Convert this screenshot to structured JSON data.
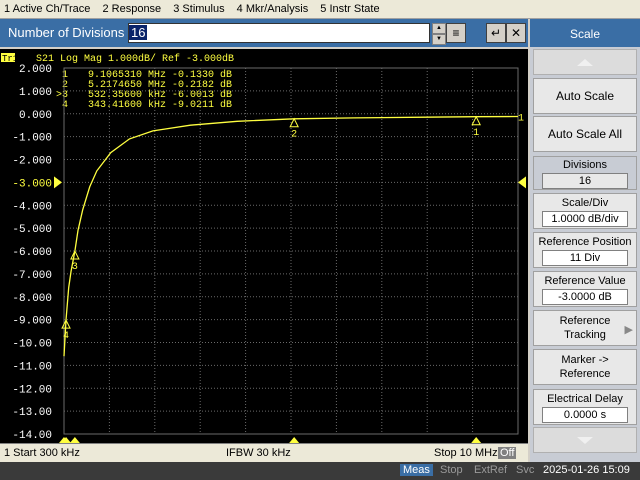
{
  "menu": [
    "1 Active Ch/Trace",
    "2 Response",
    "3 Stimulus",
    "4 Mkr/Analysis",
    "5 Instr State"
  ],
  "entry": {
    "label": "Number of Divisions",
    "value": "16"
  },
  "trace_header": {
    "badge": "Tr1",
    "text": "S21 Log Mag 1.000dB/ Ref -3.000dB"
  },
  "markers_table": [
    {
      "id": "1",
      "freq": "9.1065310 MHz",
      "val": "-0.1330 dB"
    },
    {
      "id": "2",
      "freq": "5.2174650 MHz",
      "val": "-0.2182 dB"
    },
    {
      "id": ">3",
      "freq": "532.35600 kHz",
      "val": "-6.0013 dB"
    },
    {
      "id": "4",
      "freq": "343.41600 kHz",
      "val": "-9.0211 dB"
    }
  ],
  "chart_data": {
    "type": "line",
    "ylim": [
      -14,
      2
    ],
    "xlim_hz": [
      300000,
      10000000
    ],
    "y_ticks": [
      "2.000",
      "1.000",
      "0.000",
      "-1.000",
      "-2.000",
      "-3.000",
      "-4.000",
      "-5.000",
      "-6.000",
      "-7.000",
      "-8.000",
      "-9.000",
      "-10.00",
      "-11.00",
      "-12.00",
      "-13.00",
      "-14.00"
    ],
    "reference_level": -3.0,
    "x_hz": [
      300000,
      343416,
      400000,
      450000,
      532356,
      600000,
      700000,
      850000,
      1000000,
      1300000,
      1700000,
      2200000,
      3000000,
      4000000,
      5217465,
      6500000,
      8000000,
      9106531,
      10000000
    ],
    "y_db": [
      -10.6,
      -9.02,
      -7.6,
      -6.9,
      -6.0,
      -5.1,
      -4.2,
      -3.2,
      -2.5,
      -1.7,
      -1.1,
      -0.75,
      -0.5,
      -0.33,
      -0.22,
      -0.18,
      -0.15,
      -0.13,
      -0.12
    ],
    "markers": [
      {
        "label": "1",
        "x_hz": 9106531,
        "y_db": -0.133
      },
      {
        "label": "2",
        "x_hz": 5217465,
        "y_db": -0.2182
      },
      {
        "label": "3",
        "x_hz": 532356,
        "y_db": -6.0013
      },
      {
        "label": "4",
        "x_hz": 343416,
        "y_db": -9.0211
      }
    ]
  },
  "status": {
    "start": "1  Start 300 kHz",
    "ifbw": "IFBW 30 kHz",
    "stop": "Stop 10 MHz",
    "off": "Off"
  },
  "bottom": {
    "meas": "Meas",
    "stop": "Stop",
    "extref": "ExtRef",
    "svc": "Svc",
    "datetime": "2025-01-26 15:09"
  },
  "softkeys": {
    "title": "Scale",
    "auto_scale": "Auto Scale",
    "auto_scale_all": "Auto Scale All",
    "divisions": {
      "label": "Divisions",
      "value": "16"
    },
    "scale_div": {
      "label": "Scale/Div",
      "value": "1.0000 dB/div"
    },
    "ref_pos": {
      "label": "Reference Position",
      "value": "11 Div"
    },
    "ref_val": {
      "label": "Reference Value",
      "value": "-3.0000 dB"
    },
    "ref_track": "Reference Tracking",
    "marker_ref": "Marker -> Reference",
    "elec_delay": {
      "label": "Electrical Delay",
      "value": "0.0000 s"
    }
  },
  "colors": {
    "trace": "#ffff40",
    "grid": "#6a6a6a",
    "panel_blue": "#3a6ea5"
  }
}
